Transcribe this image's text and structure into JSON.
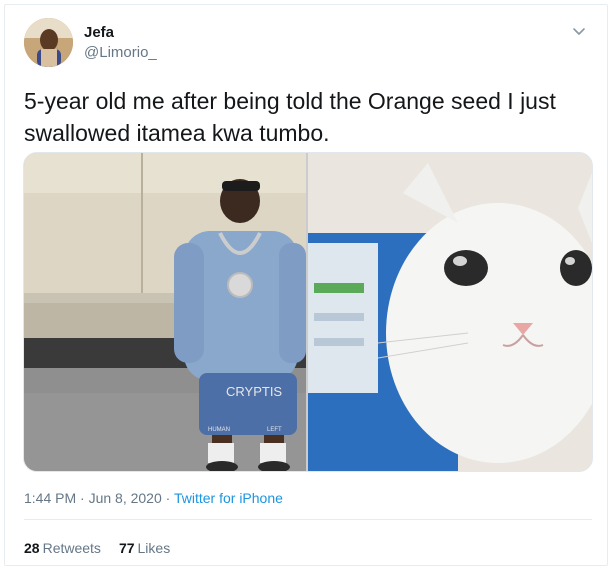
{
  "author": {
    "display_name": "Jefa",
    "handle": "@Limorio_"
  },
  "tweet": {
    "text": "5-year old me after being told the Orange seed I just swallowed itamea kwa tumbo."
  },
  "media": {
    "left_photo_text": "CRYPTIS",
    "left_photo_shorts_text": "HUMAN",
    "left_photo_shorts_text2": "LEFT"
  },
  "meta": {
    "timestamp": "1:44 PM · Jun 8, 2020",
    "separator": " · ",
    "source": "Twitter for iPhone"
  },
  "stats": {
    "retweets_count": "28",
    "retweets_label": "Retweets",
    "likes_count": "77",
    "likes_label": "Likes"
  },
  "colors": {
    "link": "#1b95e0",
    "secondary_text": "#657786",
    "divider": "#e6ecf0"
  },
  "icons": {
    "caret": "chevron-down-icon"
  }
}
